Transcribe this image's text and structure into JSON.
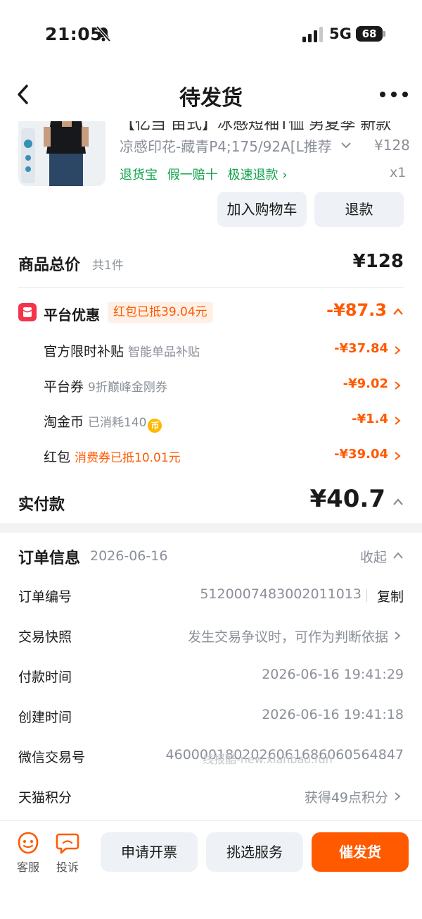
{
  "status_bar": {
    "time": "21:05",
    "network": "5G",
    "battery": "68"
  },
  "nav": {
    "title": "待发货"
  },
  "product": {
    "title_cut": "【亿当 亩式】冰感短袖T恤 男夏季 新款",
    "variant": "凉感印花-藏青P4;175/92A[L推荐",
    "price": "¥128",
    "tags": [
      "退货宝",
      "假一赔十",
      "极速退款 ›"
    ],
    "quantity": "x1",
    "add_cart_label": "加入购物车",
    "refund_label": "退款"
  },
  "total": {
    "label": "商品总价",
    "count": "共1件",
    "price": "¥128"
  },
  "platform_discount": {
    "label": "平台优惠",
    "badge": "红包已抵39.04元",
    "amount": "-¥87.3",
    "items": [
      {
        "label": "官方限时补贴",
        "note": "智能单品补贴",
        "amount": "-¥37.84"
      },
      {
        "label": "平台券",
        "note": "9折巅峰金刚券",
        "amount": "-¥9.02"
      },
      {
        "label": "淘金币",
        "note": "已消耗140",
        "amount": "-¥1.4"
      },
      {
        "label": "红包",
        "note": "消费券已抵10.01元",
        "amount": "-¥39.04"
      }
    ]
  },
  "paid": {
    "label": "实付款",
    "amount": "¥40.7"
  },
  "order_info": {
    "title": "订单信息",
    "date": "2026-06-16",
    "collapse_label": "收起",
    "rows": [
      {
        "label": "订单编号",
        "value": "5120007483002011013",
        "action": "复制"
      },
      {
        "label": "交易快照",
        "value": "发生交易争议时，可作为判断依据"
      },
      {
        "label": "付款时间",
        "value": "2026-06-16 19:41:29"
      },
      {
        "label": "创建时间",
        "value": "2026-06-16 19:41:18"
      },
      {
        "label": "微信交易号",
        "value": "4600001802026061686060564847"
      },
      {
        "label": "天猫积分",
        "value": "获得49点积分"
      }
    ],
    "watermark": "线报酷-new.xianbao.fun"
  },
  "bottom": {
    "service_label": "客服",
    "complaint_label": "投诉",
    "invoice_label": "申请开票",
    "select_service_label": "挑选服务",
    "urge_label": "催发货"
  },
  "colors": {
    "accent": "#ff5a00",
    "green": "#10a34c",
    "red": "#f5334a"
  }
}
